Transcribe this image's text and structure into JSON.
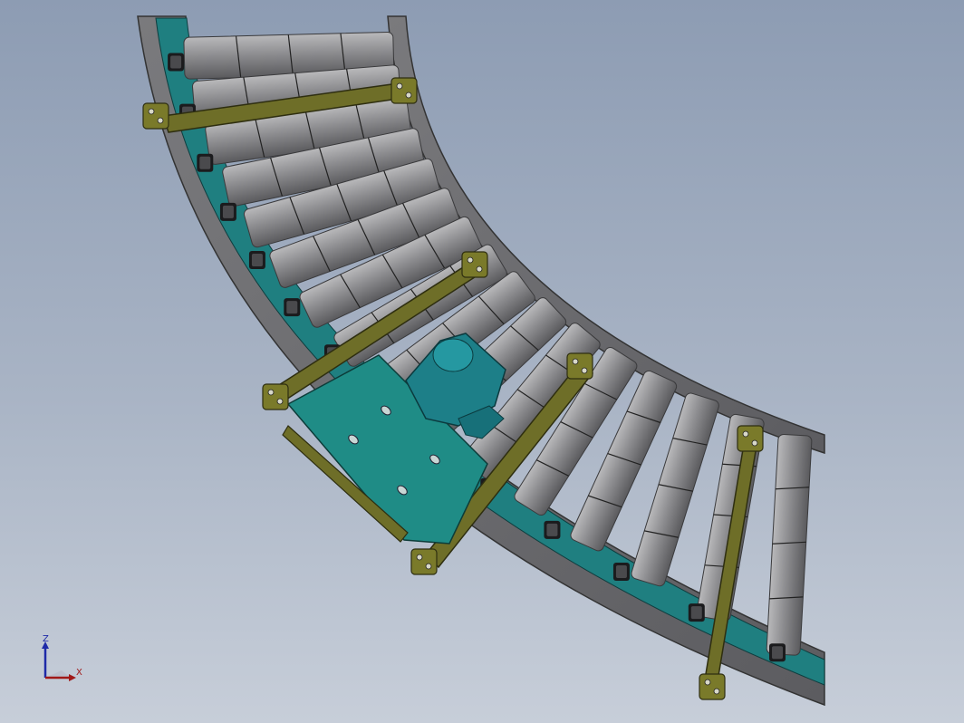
{
  "view": {
    "background_top": "#8d9cb3",
    "background_bottom": "#c7ced9"
  },
  "model": {
    "description_visible": false,
    "frame_color": "#6d6d70",
    "roller_color": "#8a8a8c",
    "chain_color": "#1f7f80",
    "bracket_color": "#7a7a2a",
    "motor_color": "#1b7d85"
  },
  "triad": {
    "z_label": "Z",
    "x_label": "X",
    "z_color": "#1e2aa8",
    "x_color": "#a01818"
  }
}
